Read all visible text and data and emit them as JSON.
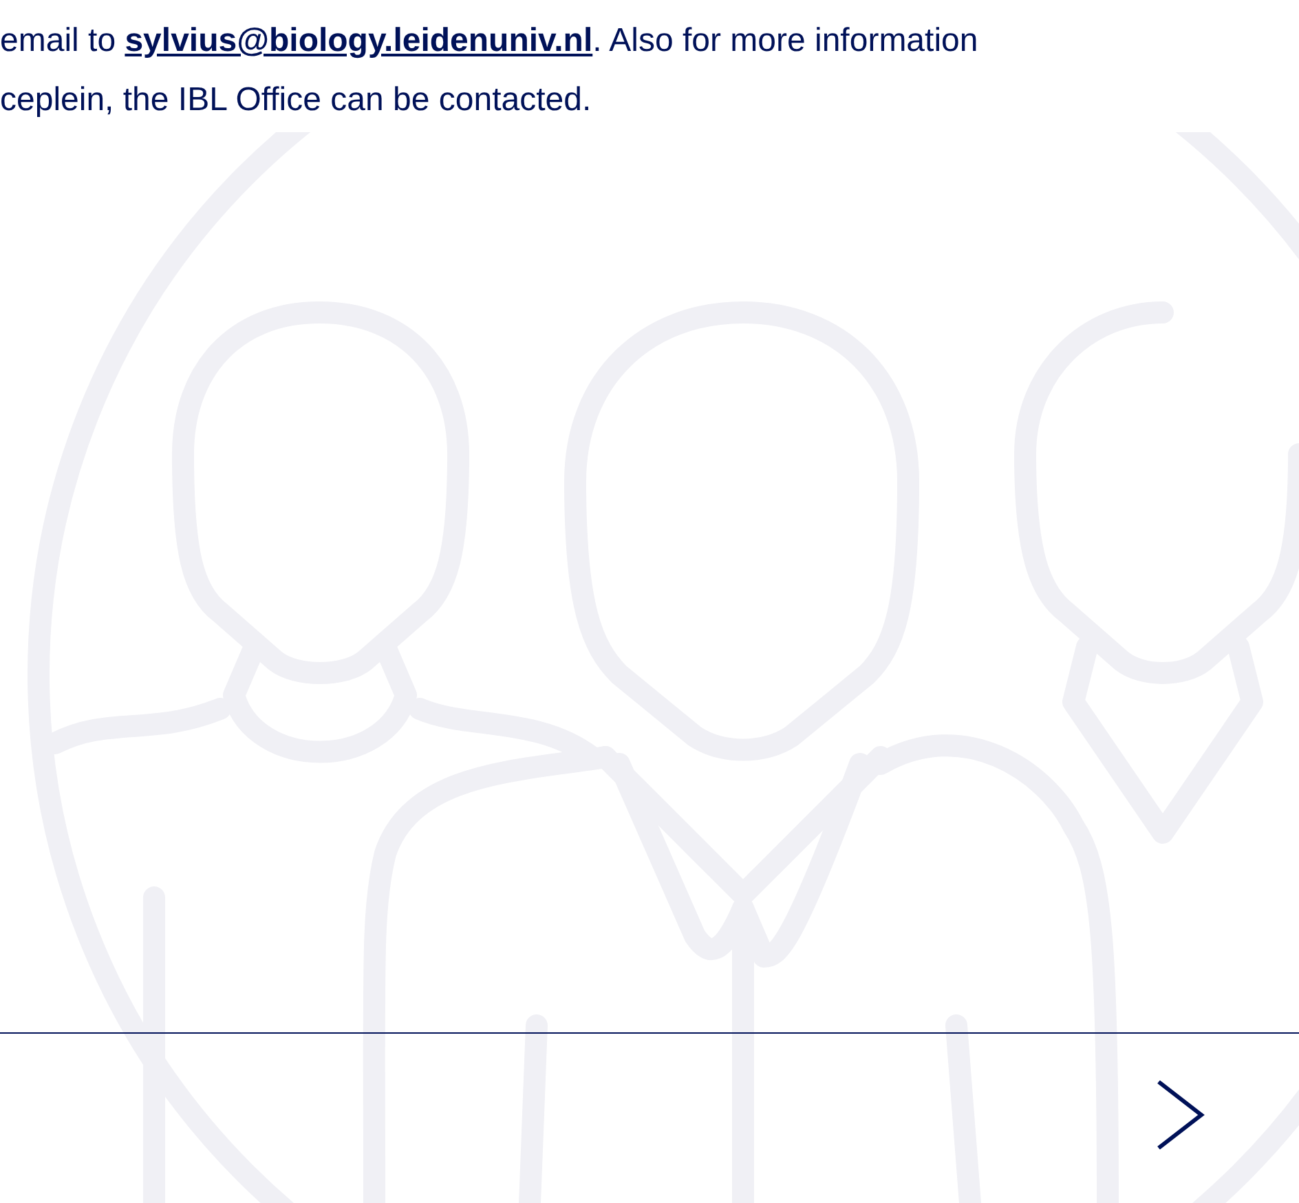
{
  "paragraph": {
    "before": "email to ",
    "link": "sylvius@biology.leidenuniv.nl",
    "after": ". Also for more information",
    "line_2": "ceplein, the IBL Office can be contacted."
  }
}
